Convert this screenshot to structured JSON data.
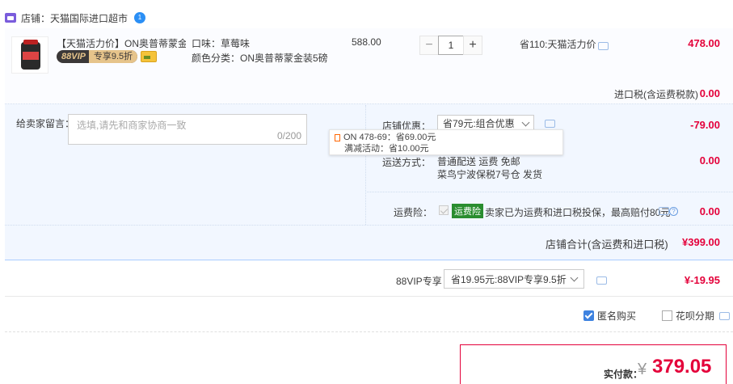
{
  "shop": {
    "label": "店铺：天猫国际进口超市",
    "wangwang": "1"
  },
  "item": {
    "title": "【天猫活力价】ON奥普蒂蒙金...",
    "vip_label": "88VIP",
    "vip_discount": "专享9.5折",
    "flavor": "口味：草莓味",
    "color_category": "颜色分类：ON奥普蒂蒙金装5磅",
    "unit_price": "588.00",
    "quantity": "1",
    "qty_minus": "−",
    "qty_plus": "+",
    "promo": "省110:天猫活力价",
    "subtotal": "478.00"
  },
  "import_tax": {
    "label": "进口税(含运费税款)",
    "value": "0.00"
  },
  "message": {
    "label": "给卖家留言：",
    "placeholder": "选填,请先和商家协商一致",
    "count": "0/200"
  },
  "shop_coupon": {
    "label": "店铺优惠：",
    "selected": "省79元:组合优惠",
    "value": "-79.00"
  },
  "tooltip": {
    "line1": "ON 478-69：省69.00元",
    "line2": "满减活动：省10.00元"
  },
  "shipping": {
    "label": "运送方式：",
    "line1": "普通配送 运费 免邮",
    "line2": "菜鸟宁波保税7号仓  发货",
    "value": "0.00"
  },
  "insurance": {
    "label": "运费险：",
    "tag": "运费险",
    "text": "卖家已为运费和进口税投保，最高赔付80元",
    "value": "0.00"
  },
  "shop_total": {
    "label": "店铺合计(含运费和进口税)",
    "value": "¥399.00"
  },
  "vip": {
    "label": "88VIP专享",
    "selected": "省19.95元:88VIP专享9.5折",
    "value": "¥-19.95"
  },
  "options": {
    "anonymous": "匿名购买",
    "huabei": "花呗分期"
  },
  "payment": {
    "label": "实付款：",
    "currency": "¥",
    "value": "379.05"
  },
  "colors": {
    "accent_red": "#e4003a",
    "panel_blue": "#f2f7ff",
    "border_blue": "#b2d1ff",
    "checkbox_blue": "#3d82e0",
    "insurance_green": "#2a8d2f"
  }
}
